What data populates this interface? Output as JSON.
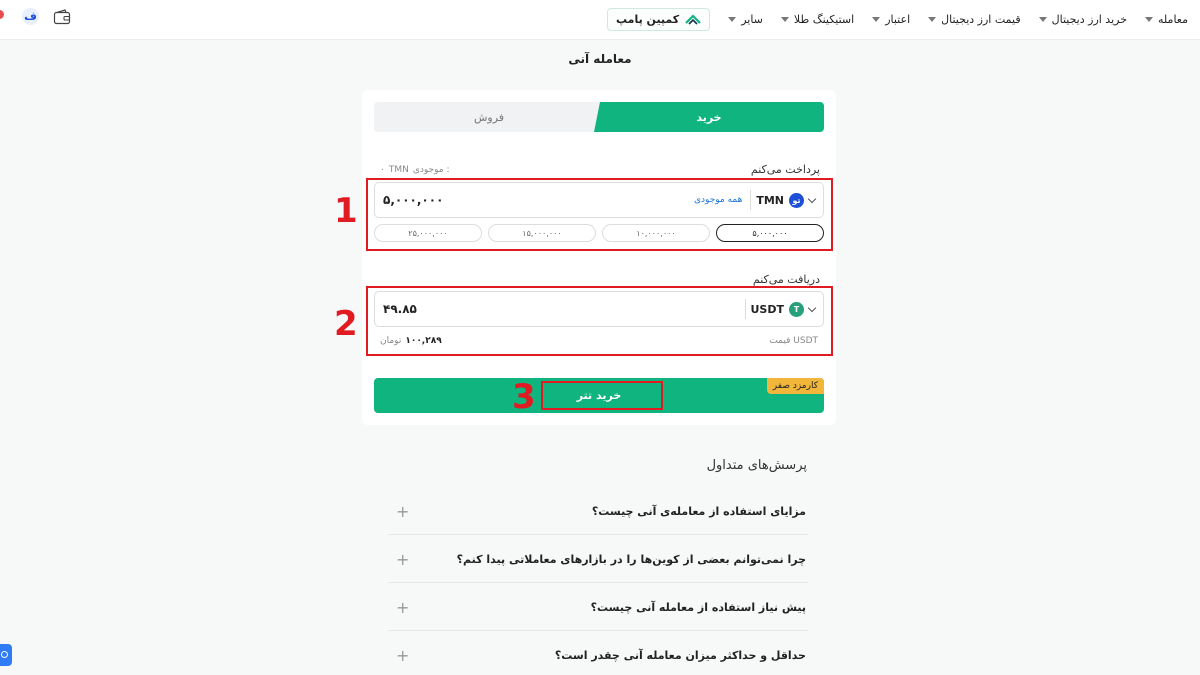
{
  "nav": {
    "items": [
      {
        "label": "معامله",
        "dropdown": true
      },
      {
        "label": "خرید ارز دیجیتال",
        "dropdown": true
      },
      {
        "label": "قیمت ارز دیجیتال",
        "dropdown": true
      },
      {
        "label": "اعتبار",
        "dropdown": true
      },
      {
        "label": "استیکینگ طلا",
        "dropdown": true
      },
      {
        "label": "سایر",
        "dropdown": true
      }
    ],
    "campaign_label": "کمپین پامپ",
    "user_initial": "ف"
  },
  "page_title": "معامله آنی",
  "tabs": {
    "buy": "خرید",
    "sell": "فروش"
  },
  "pay": {
    "label": "پرداخت می‌کنم",
    "balance_label": "موجودی :",
    "balance_currency": "TMN",
    "balance_value": "۰",
    "amount": "۵,۰۰۰,۰۰۰",
    "currency": "TMN",
    "currency_icon_text": "تو",
    "all_balance": "همه موجودی",
    "chips": [
      "۵,۰۰۰,۰۰۰",
      "۱۰,۰۰۰,۰۰۰",
      "۱۵,۰۰۰,۰۰۰",
      "۲۵,۰۰۰,۰۰۰"
    ],
    "active_chip": 0
  },
  "receive": {
    "label": "دریافت می‌کنم",
    "amount": "۴۹.۸۵",
    "currency": "USDT",
    "currency_icon_text": "T",
    "price_label": "قیمت USDT",
    "price_value": "۱۰۰,۲۸۹",
    "price_unit": "تومان"
  },
  "buy_button": {
    "label": "خرید تتر",
    "fee_badge": "کارمزد صفر"
  },
  "annotations": [
    "1",
    "2",
    "3"
  ],
  "faq": {
    "title": "پرسش‌های متداول",
    "items": [
      "مزایای استفاده از معامله‌ی آنی چیست؟",
      "چرا نمی‌توانم بعضی از کوین‌ها را در بازارهای معاملاتی پیدا کنم؟",
      "پیش نیاز استفاده از معامله آنی چیست؟",
      "حداقل و حداکثر میزان معامله آنی چقدر است؟"
    ]
  },
  "colors": {
    "primary": "#0fb47f",
    "annotation": "#e11b22",
    "fee_badge": "#f2b73a",
    "link": "#1a73d9",
    "usdt": "#26a17b",
    "tmn": "#1d4fd8"
  }
}
